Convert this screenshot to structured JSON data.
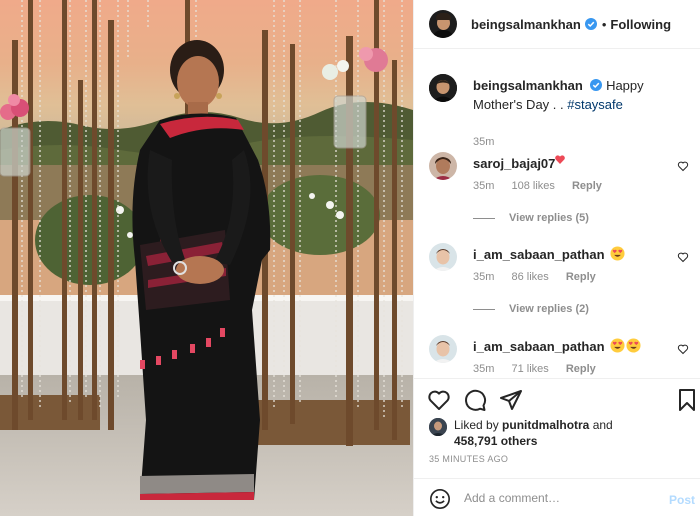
{
  "header": {
    "username": "beingsalmankhan",
    "dot": "•",
    "follow_state": "Following"
  },
  "caption": {
    "username": "beingsalmankhan",
    "text": "Happy Mother's Day . . ",
    "hashtag": "#staysafe",
    "time": "35m"
  },
  "comments": [
    {
      "username": "saroj_bajaj07",
      "text": "",
      "time": "35m",
      "likes": "108 likes",
      "reply": "Reply",
      "view_replies": "View replies (5)"
    },
    {
      "username": "i_am_sabaan_pathan",
      "text": "",
      "time": "35m",
      "likes": "86 likes",
      "reply": "Reply",
      "view_replies": "View replies (2)"
    },
    {
      "username": "i_am_sabaan_pathan",
      "text": "",
      "time": "35m",
      "likes": "71 likes",
      "reply": "Reply"
    }
  ],
  "likes": {
    "prefix": "Liked by ",
    "user": "punitdmalhotra",
    "and": " and",
    "count": "458,791 others"
  },
  "time_ago": "35 MINUTES AGO",
  "add_comment": {
    "placeholder": "Add a comment…",
    "post_label": "Post"
  },
  "colors": {
    "verified": "#3897f0",
    "link": "#00376b",
    "muted": "#8e8e8e",
    "post_disabled": "#b3dbff",
    "heart_emoji": "#ed4956"
  },
  "icons": [
    "verified-badge-icon",
    "heart-icon",
    "comment-icon",
    "share-icon",
    "bookmark-icon",
    "emoji-icon",
    "heart-eyes-emoji",
    "red-heart-emoji"
  ]
}
